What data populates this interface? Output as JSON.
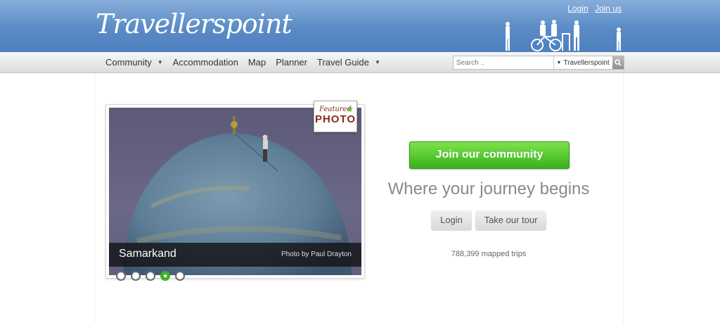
{
  "header": {
    "logo_text": "Travellerspoint",
    "login_link": "Login",
    "join_link": "Join us",
    "background_color": "#5a8bc6"
  },
  "nav": {
    "items": [
      {
        "label": "Community",
        "has_dropdown": true
      },
      {
        "label": "Accommodation",
        "has_dropdown": false
      },
      {
        "label": "Map",
        "has_dropdown": false
      },
      {
        "label": "Planner",
        "has_dropdown": false
      },
      {
        "label": "Travel Guide",
        "has_dropdown": true
      }
    ],
    "search": {
      "placeholder": "Search ..",
      "scope": "Travellerspoint",
      "button_icon": "search-icon"
    }
  },
  "featured": {
    "badge_top": "Featured",
    "badge_bottom": "PHOTO",
    "place": "Samarkand",
    "credit": "Photo by Paul Drayton",
    "active_slide": 4,
    "slide_count": 5
  },
  "cta": {
    "join_button": "Join our community",
    "tagline": "Where your journey begins",
    "login_button": "Login",
    "tour_button": "Take our tour",
    "stats": "788,399 mapped trips",
    "accent_color": "#3fae2b"
  }
}
